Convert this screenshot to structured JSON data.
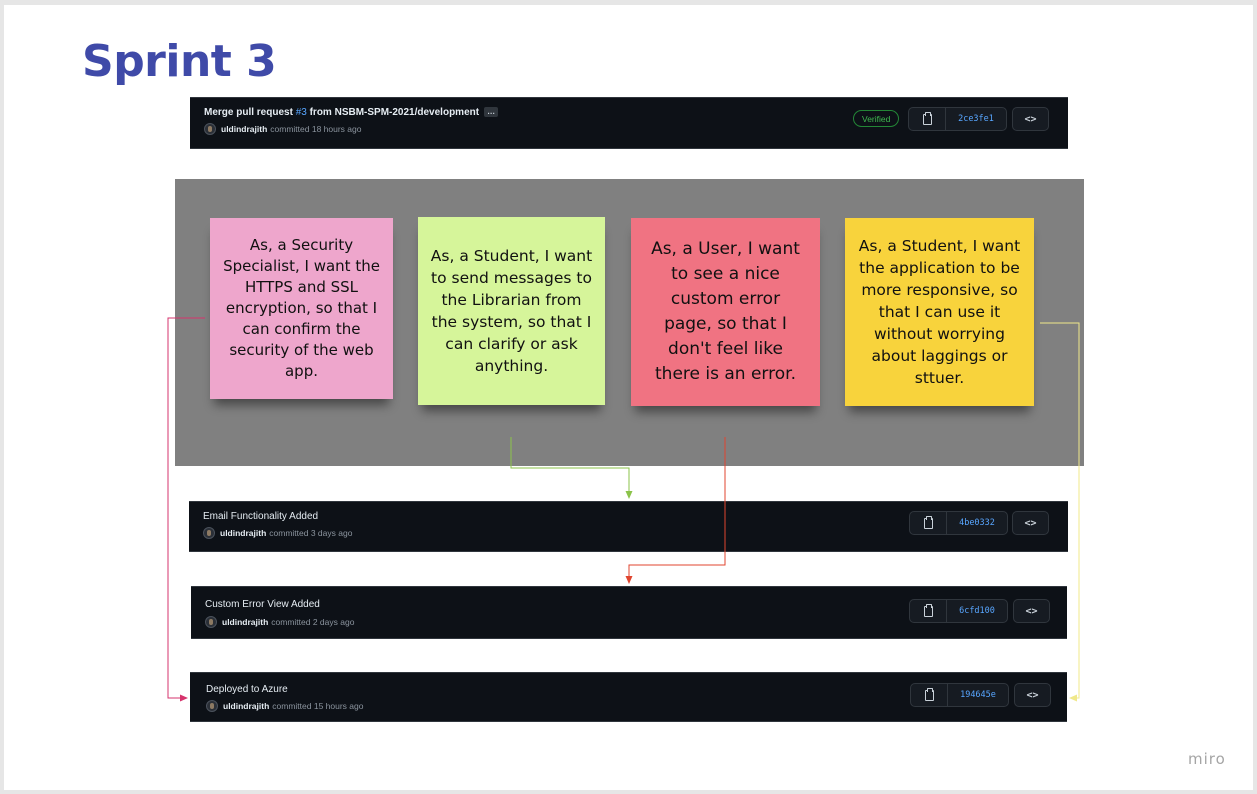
{
  "title": "Sprint 3",
  "watermark": "miro",
  "commits": {
    "merge": {
      "message": "Merge pull request ",
      "pr": "#3",
      "message_suffix": " from NSBM-SPM-2021/development",
      "ellipsis": "…",
      "author": "uldindrajith",
      "time": "committed 18 hours ago",
      "badge": "Verified",
      "sha": "2ce3fe1"
    },
    "email": {
      "message": "Email Functionality Added",
      "author": "uldindrajith",
      "time": "committed 3 days ago",
      "sha": "4be0332"
    },
    "error_view": {
      "message": "Custom Error View Added",
      "author": "uldindrajith",
      "time": "committed 2 days ago",
      "sha": "6cfd100"
    },
    "azure": {
      "message": "Deployed to Azure",
      "author": "uldindrajith",
      "time": "committed 15 hours ago",
      "sha": "194645e"
    },
    "browse_label": "<>"
  },
  "notes": {
    "security": "As, a Security Specialist, I want the HTTPS and SSL encryption, so that I can confirm the security of the web app.",
    "messages": "As, a Student, I want to send messages to the Librarian from the system, so that I can clarify or ask anything.",
    "error_page": "As, a User, I want to see a nice custom error page, so that I don't feel like there is an error.",
    "responsive": "As, a Student, I want the application to be more responsive, so that I can use it without worrying about laggings or sttuer."
  },
  "colors": {
    "title": "#3f4aa8",
    "note_pink": "#eea6cc",
    "note_green": "#d6f59a",
    "note_red": "#f07382",
    "note_yellow": "#f8d33c",
    "connector_pink": "#d6336c",
    "connector_green": "#8bc34a",
    "connector_red": "#e0452f",
    "connector_yellow": "#f0e88a"
  }
}
